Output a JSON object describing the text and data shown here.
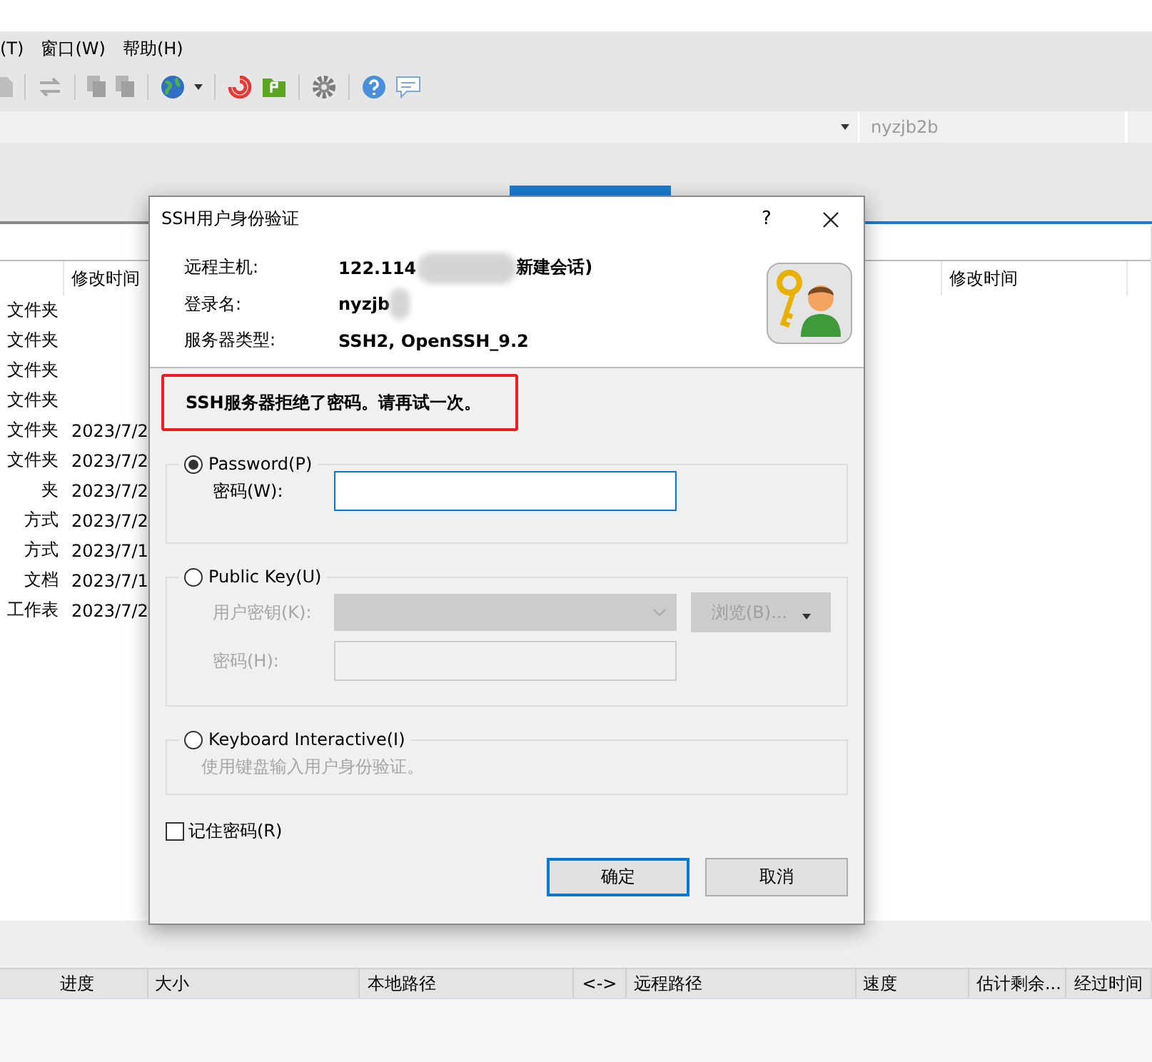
{
  "menu": [
    {
      "label": "(T)"
    },
    {
      "label": "窗口(W)"
    },
    {
      "label": "帮助(H)"
    }
  ],
  "address_bar": {
    "username": "nyzjb2b"
  },
  "tabs": [
    {
      "selected": true
    }
  ],
  "left_pane": {
    "columns": [
      "修改时间"
    ],
    "rows": [
      {
        "type": "文件夹"
      },
      {
        "type": "文件夹"
      },
      {
        "type": "文件夹"
      },
      {
        "type": "文件夹"
      },
      {
        "type": "文件夹",
        "modified": "2023/7/2"
      },
      {
        "type": "文件夹",
        "modified": "2023/7/2"
      },
      {
        "type": "夹",
        "modified": "2023/7/2"
      },
      {
        "type": "方式",
        "modified": "2023/7/2"
      },
      {
        "type": "方式",
        "modified": "2023/7/1"
      },
      {
        "type": "文档",
        "modified": "2023/7/1"
      },
      {
        "type": "工作表",
        "modified": "2023/7/2"
      }
    ]
  },
  "right_pane": {
    "columns": [
      "修改时间"
    ]
  },
  "dialog": {
    "title": "SSH用户身份验证",
    "help": "?",
    "info": [
      {
        "label": "远程主机:",
        "value": "122.114",
        "redacted": true,
        "after": "新建会话)"
      },
      {
        "label": "登录名:",
        "value": "nyzjb",
        "redacted": true
      },
      {
        "label": "服务器类型:",
        "value": "SSH2, OpenSSH_9.2"
      }
    ],
    "error": "SSH服务器拒绝了密码。请再试一次。",
    "methods": [
      {
        "label": "Password(P)",
        "selected": true,
        "disabled": false,
        "fields": [
          {
            "label": "密码(W):",
            "kind": "input",
            "focused": true
          }
        ]
      },
      {
        "label": "Public Key(U)",
        "selected": false,
        "disabled": true,
        "fields": [
          {
            "label": "用户密钥(K):",
            "kind": "select",
            "button": "浏览(B)..."
          },
          {
            "label": "密码(H):",
            "kind": "input",
            "focused": false
          }
        ]
      },
      {
        "label": "Keyboard Interactive(I)",
        "selected": false,
        "disabled": true,
        "note": "使用键盘输入用户身份验证。"
      }
    ],
    "remember": {
      "label": "记住密码(R)",
      "checked": false
    },
    "buttons": [
      {
        "label": "确定",
        "default": true
      },
      {
        "label": "取消",
        "default": false
      }
    ]
  },
  "transfers": {
    "columns": [
      {
        "label": "进度"
      },
      {
        "label": "大小"
      },
      {
        "label": "本地路径"
      },
      {
        "label": "<->"
      },
      {
        "label": "远程路径"
      },
      {
        "label": "速度"
      },
      {
        "label": "估计剩余..."
      },
      {
        "label": "经过时间"
      }
    ]
  }
}
